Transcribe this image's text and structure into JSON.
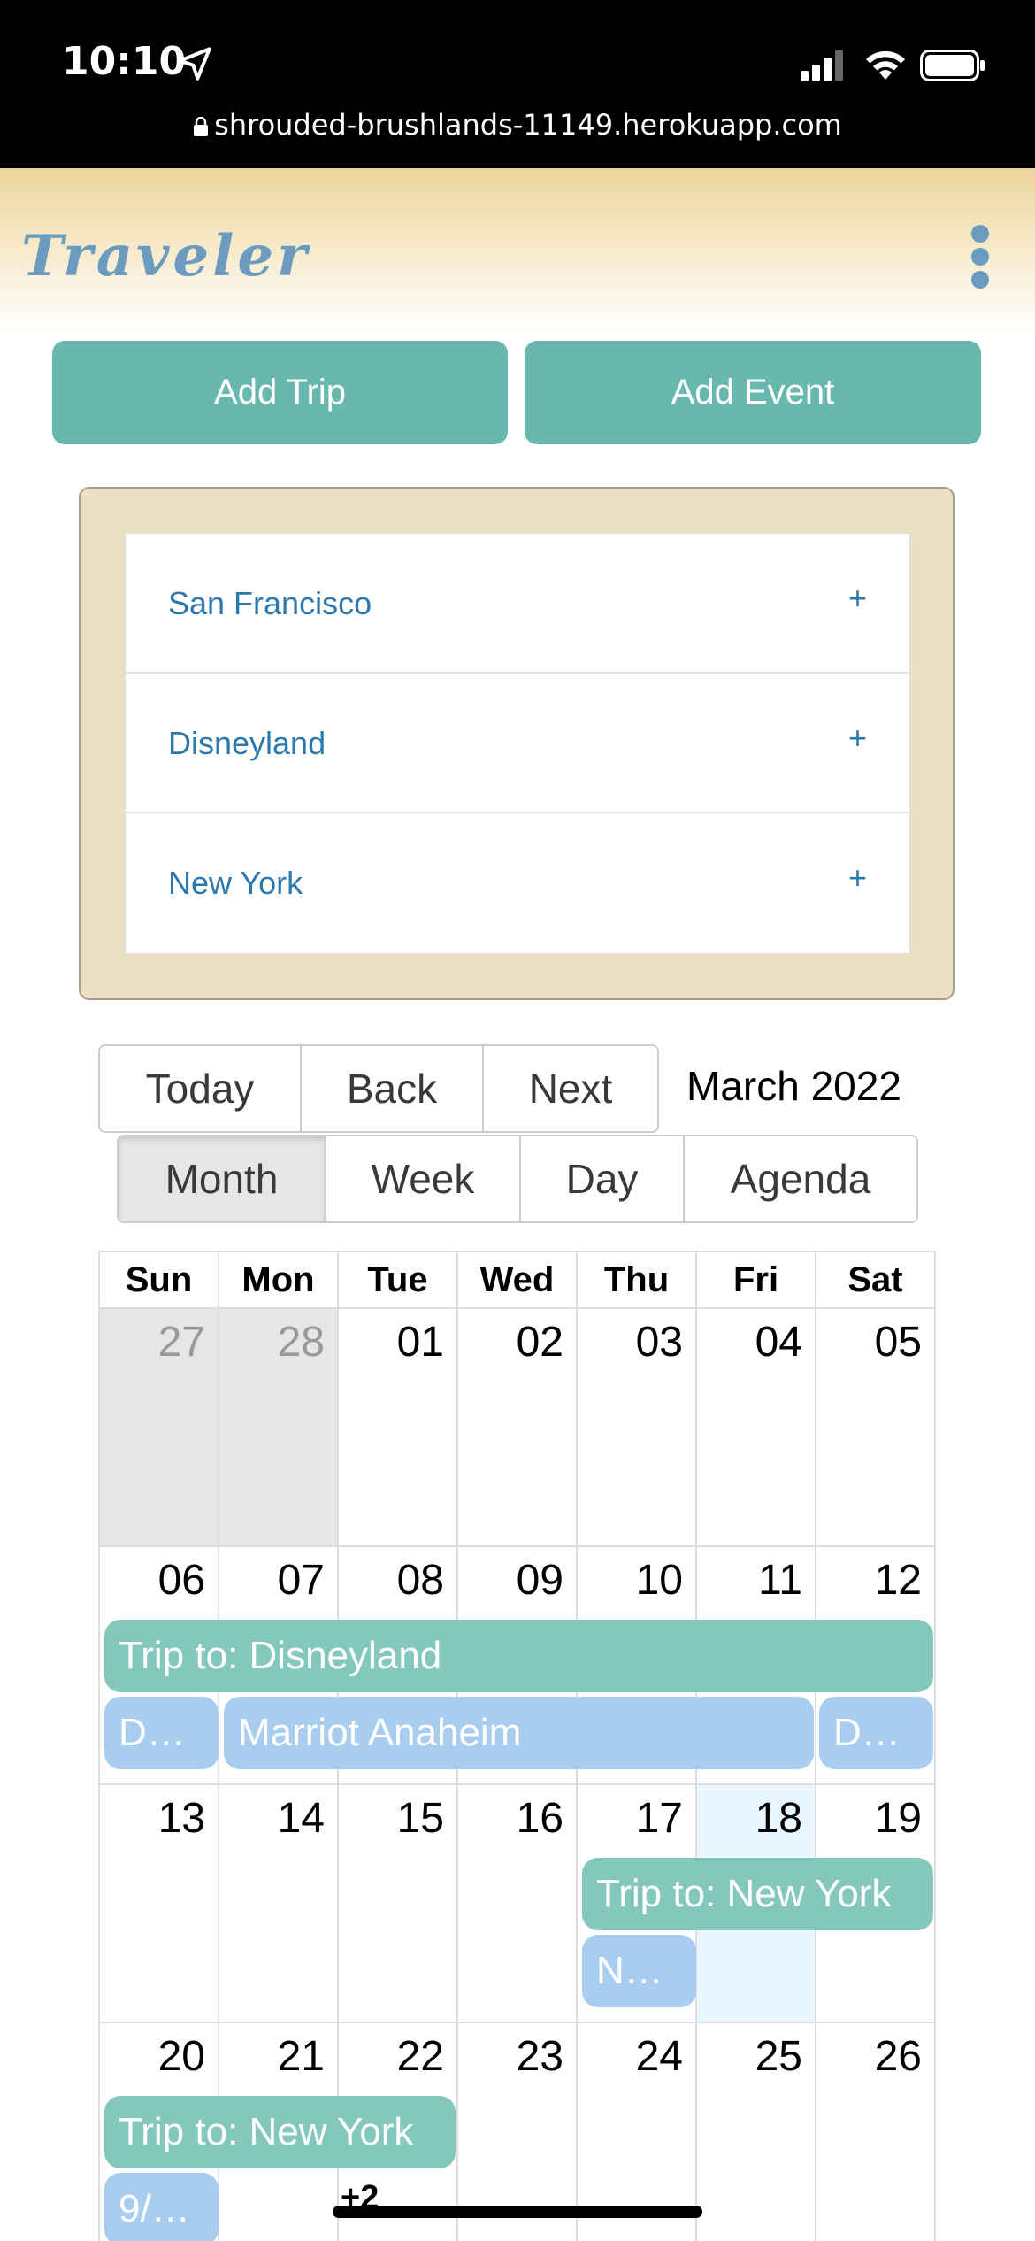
{
  "status_bar": {
    "time": "10:10",
    "url": "shrouded-brushlands-11149.herokuapp.com"
  },
  "app": {
    "logo": "Traveler",
    "menu_icon": "kebab-menu-icon"
  },
  "actions": {
    "add_trip": "Add Trip",
    "add_event": "Add Event"
  },
  "trips": [
    {
      "name": "San Francisco",
      "expand": "+"
    },
    {
      "name": "Disneyland",
      "expand": "+"
    },
    {
      "name": "New York",
      "expand": "+"
    }
  ],
  "calendar": {
    "nav": {
      "today": "Today",
      "back": "Back",
      "next": "Next"
    },
    "label": "March 2022",
    "views": {
      "month": "Month",
      "week": "Week",
      "day": "Day",
      "agenda": "Agenda",
      "active": "Month"
    },
    "weekdays": [
      "Sun",
      "Mon",
      "Tue",
      "Wed",
      "Thu",
      "Fri",
      "Sat"
    ],
    "weeks": [
      [
        "27",
        "28",
        "01",
        "02",
        "03",
        "04",
        "05"
      ],
      [
        "06",
        "07",
        "08",
        "09",
        "10",
        "11",
        "12"
      ],
      [
        "13",
        "14",
        "15",
        "16",
        "17",
        "18",
        "19"
      ],
      [
        "20",
        "21",
        "22",
        "23",
        "24",
        "25",
        "26"
      ]
    ],
    "events": {
      "trip_disneyland": "Trip to: Disneyland",
      "d_left": "D…",
      "marriot": "Marriot Anaheim",
      "d_right": "D…",
      "trip_newyork_1": "Trip to: New York",
      "n_item": "N…",
      "trip_newyork_2": "Trip to: New York",
      "date_item": "9/…",
      "more": "+2"
    }
  }
}
